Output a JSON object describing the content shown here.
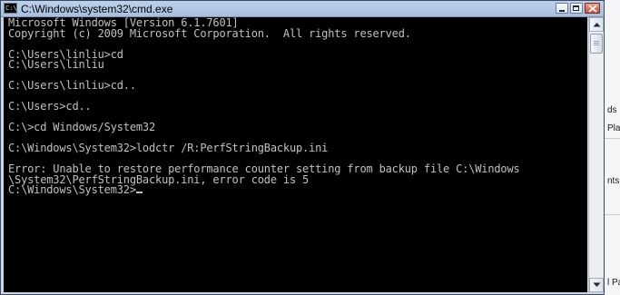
{
  "window": {
    "title": "C:\\Windows\\system32\\cmd.exe",
    "icon_text": "C:\\"
  },
  "console": {
    "lines": [
      "Microsoft Windows [Version 6.1.7601]",
      "Copyright (c) 2009 Microsoft Corporation.  All rights reserved.",
      "",
      "C:\\Users\\linliu>cd",
      "C:\\Users\\linliu",
      "",
      "C:\\Users\\linliu>cd..",
      "",
      "C:\\Users>cd..",
      "",
      "C:\\>cd Windows/System32",
      "",
      "C:\\Windows\\System32>lodctr /R:PerfStringBackup.ini",
      "",
      "Error: Unable to restore performance counter setting from backup file C:\\Windows",
      "\\System32\\PerfStringBackup.ini, error code is 5"
    ],
    "prompt": "C:\\Windows\\System32>"
  },
  "background_window": {
    "fragments": [
      "ds",
      "Pla",
      "nts",
      "l Pa"
    ]
  },
  "colors": {
    "console_bg": "#000000",
    "console_fg": "#c0c0c0",
    "titlebar": "#b4c9e6",
    "close_button": "#c8503a"
  },
  "icons": {
    "window_icon": "cmd-console-icon",
    "minimize": "minimize-icon",
    "maximize": "maximize-icon",
    "close": "close-icon",
    "scroll_up": "arrow-up-icon",
    "scroll_down": "arrow-down-icon"
  }
}
